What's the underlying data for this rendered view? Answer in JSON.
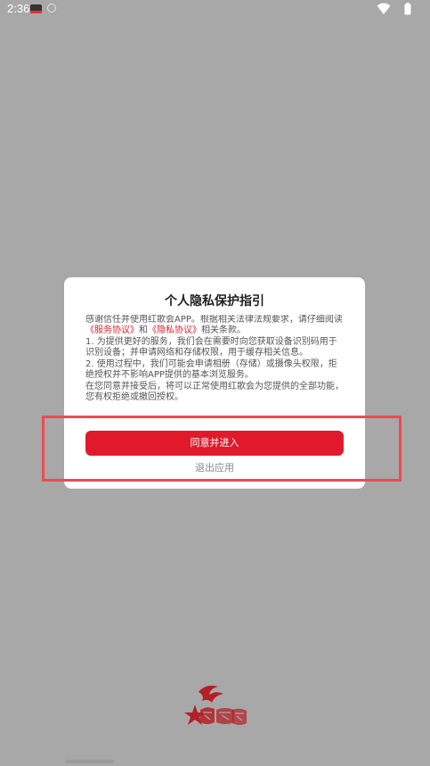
{
  "status_bar": {
    "time": "2:36",
    "icons": [
      "app-icon",
      "circle-icon",
      "wifi-icon",
      "battery-icon"
    ]
  },
  "dialog": {
    "title": "个人隐私保护指引",
    "intro_text_1": "感谢信任并使用红歌会APP。根据相关法律法规要求，请仔细阅读",
    "service_agreement_link": "《服务协议》",
    "intro_and": "和",
    "privacy_agreement_link": "《隐私协议》",
    "intro_text_2": "相关条款。",
    "paragraph_1": "1. 为提供更好的服务，我们会在需要时向您获取设备识别码用于识别设备；并申请网络和存储权限，用于缓存相关信息。",
    "paragraph_2": "2. 使用过程中，我们可能会申请相册（存储）或摄像头权限，拒绝授权并不影响APP提供的基本浏览服务。",
    "paragraph_3": "在您同意并接受后，将可以正常使用红歌会为您提供的全部功能，您有权拒绝或撤回授权。",
    "agree_button": "同意并进入",
    "exit_link": "退出应用"
  },
  "colors": {
    "accent_red": "#e01a2b",
    "overlay": "#a8a8a8",
    "highlight": "#ef4b50"
  },
  "logo": {
    "icon": "hongge-logo-icon"
  }
}
